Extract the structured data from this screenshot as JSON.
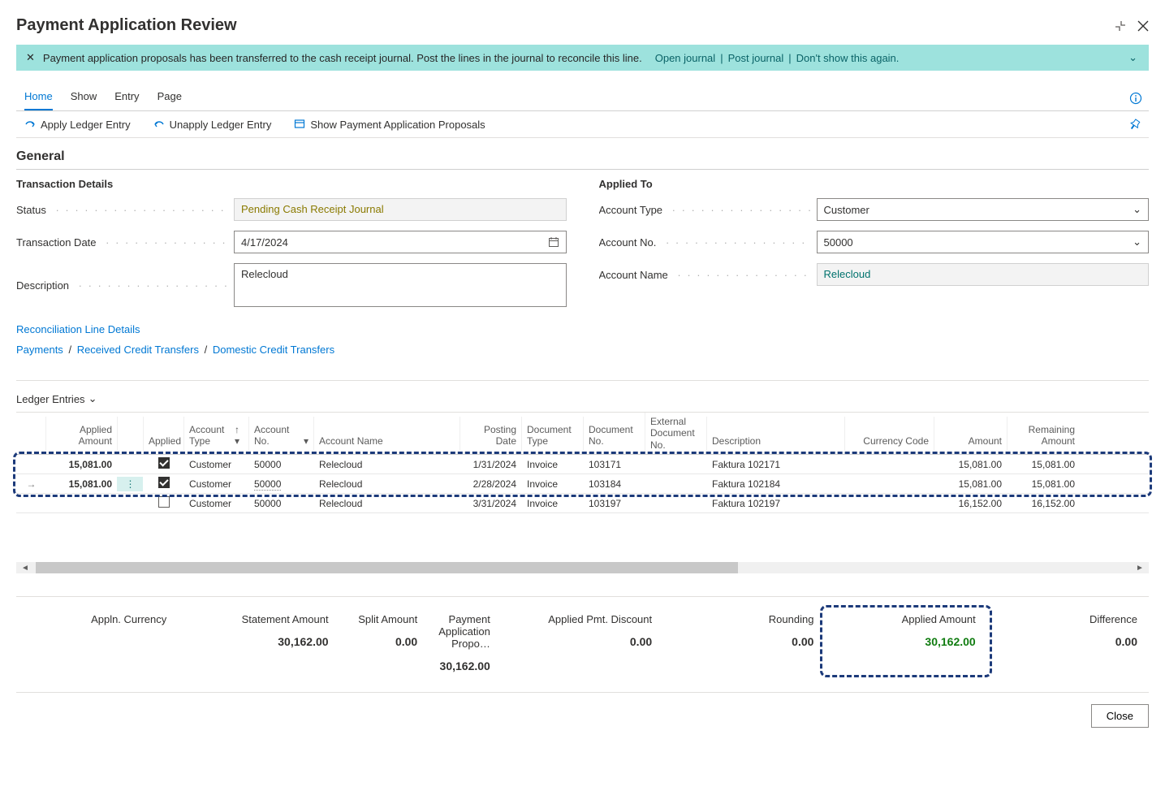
{
  "title": "Payment Application Review",
  "notification": {
    "text": "Payment application proposals has been transferred to the cash receipt journal. Post the lines in the journal to reconcile this line.",
    "link1": "Open journal",
    "link2": "Post journal",
    "link3": "Don't show this again."
  },
  "tabs": {
    "home": "Home",
    "show": "Show",
    "entry": "Entry",
    "page": "Page"
  },
  "actions": {
    "apply": "Apply Ledger Entry",
    "unapply": "Unapply Ledger Entry",
    "show_proposals": "Show Payment Application Proposals"
  },
  "section_general": "General",
  "tx_details": {
    "heading": "Transaction Details",
    "status_label": "Status",
    "status_value": "Pending Cash Receipt Journal",
    "date_label": "Transaction Date",
    "date_value": "4/17/2024",
    "desc_label": "Description",
    "desc_value": "Relecloud"
  },
  "applied_to": {
    "heading": "Applied To",
    "acct_type_label": "Account Type",
    "acct_type_value": "Customer",
    "acct_no_label": "Account No.",
    "acct_no_value": "50000",
    "acct_name_label": "Account Name",
    "acct_name_value": "Relecloud"
  },
  "links": {
    "recon": "Reconciliation Line Details",
    "bc1": "Payments",
    "bc2": "Received Credit Transfers",
    "bc3": "Domestic Credit Transfers"
  },
  "ledger_title": "Ledger Entries",
  "grid_header": {
    "applied_amount": "Applied Amount",
    "applied": "Applied",
    "acct_type": "Account Type",
    "acct_no": "Account No.",
    "acct_name": "Account Name",
    "posting_date": "Posting Date",
    "doc_type": "Document Type",
    "doc_no": "Document No.",
    "ext_doc_no": "External Document No.",
    "description": "Description",
    "currency": "Currency Code",
    "amount": "Amount",
    "remaining": "Remaining Amount"
  },
  "rows": [
    {
      "applied_amount": "15,081.00",
      "applied": true,
      "acct_type": "Customer",
      "acct_no": "50000",
      "acct_name": "Relecloud",
      "posting_date": "1/31/2024",
      "doc_type": "Invoice",
      "doc_no": "103171",
      "ext_doc_no": "",
      "description": "Faktura 102171",
      "currency": "",
      "amount": "15,081.00",
      "remaining": "15,081.00",
      "selected": false
    },
    {
      "applied_amount": "15,081.00",
      "applied": true,
      "acct_type": "Customer",
      "acct_no": "50000",
      "acct_name": "Relecloud",
      "posting_date": "2/28/2024",
      "doc_type": "Invoice",
      "doc_no": "103184",
      "ext_doc_no": "",
      "description": "Faktura 102184",
      "currency": "",
      "amount": "15,081.00",
      "remaining": "15,081.00",
      "selected": true
    },
    {
      "applied_amount": "",
      "applied": false,
      "acct_type": "Customer",
      "acct_no": "50000",
      "acct_name": "Relecloud",
      "posting_date": "3/31/2024",
      "doc_type": "Invoice",
      "doc_no": "103197",
      "ext_doc_no": "",
      "description": "Faktura 102197",
      "currency": "",
      "amount": "16,152.00",
      "remaining": "16,152.00",
      "selected": false
    }
  ],
  "totals": {
    "appln_currency_label": "Appln. Currency",
    "appln_currency_value": "",
    "statement_label": "Statement Amount",
    "statement_value": "30,162.00",
    "split_label": "Split Amount",
    "split_value": "0.00",
    "propo_label": "Payment Application Propo…",
    "propo_value": "30,162.00",
    "discount_label": "Applied Pmt. Discount",
    "discount_value": "0.00",
    "rounding_label": "Rounding",
    "rounding_value": "0.00",
    "applied_label": "Applied Amount",
    "applied_value": "30,162.00",
    "diff_label": "Difference",
    "diff_value": "0.00"
  },
  "close_btn": "Close"
}
